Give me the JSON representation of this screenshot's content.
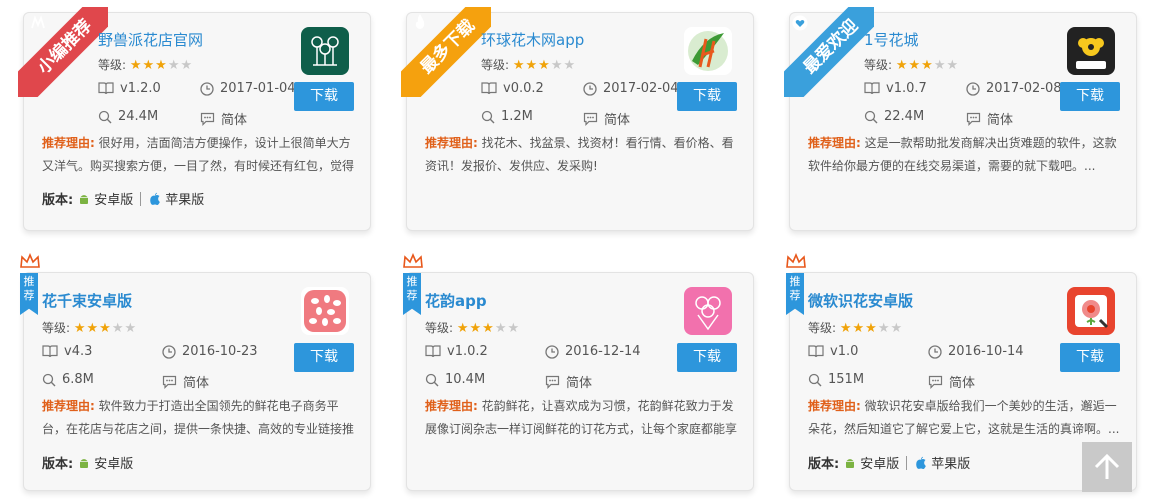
{
  "common": {
    "grade_label": "等级:",
    "download_label": "下载",
    "reason_label": "推荐理由:",
    "version_label": "版本:",
    "android_label": "安卓版",
    "ios_label": "苹果版"
  },
  "cards": [
    {
      "ribbon": "小编推荐",
      "title": "野兽派花店官网",
      "stars": "★★★",
      "stars_off": "★★",
      "version": "v1.2.0",
      "date": "2017-01-04",
      "size": "24.4M",
      "lang": "简体",
      "reason": "很好用，洁面简洁方便操作，设计上很简单大方又洋气。购买搜索方便，一目了然，有时候还有红包，觉得",
      "has_ios": true
    },
    {
      "ribbon": "最多下载",
      "title": "环球花木网app",
      "stars": "★★★",
      "stars_off": "★★",
      "version": "v0.0.2",
      "date": "2017-02-04",
      "size": "1.2M",
      "lang": "简体",
      "reason": "找花木、找盆景、找资材！看行情、看价格、看资讯！发报价、发供应、发采购!",
      "has_ios": false
    },
    {
      "ribbon": "最爱欢迎",
      "title": "1号花城",
      "stars": "★★★",
      "stars_off": "★★",
      "version": "v1.0.7",
      "date": "2017-02-08",
      "size": "22.4M",
      "lang": "简体",
      "reason": "这是一款帮助批发商解决出货难题的软件，这款软件给你最方便的在线交易渠道，需要的就下载吧。...",
      "has_ios": false
    },
    {
      "badge": "推荐",
      "title": "花千束安卓版",
      "stars": "★★★",
      "stars_off": "★★",
      "version": "v4.3",
      "date": "2016-10-23",
      "size": "6.8M",
      "lang": "简体",
      "reason": "软件致力于打造出全国领先的鲜花电子商务平台，在花店与花店之间，提供一条快捷、高效的专业链接推",
      "has_ios": false
    },
    {
      "badge": "推荐",
      "title": "花韵app",
      "stars": "★★★",
      "stars_off": "★★",
      "version": "v1.0.2",
      "date": "2016-12-14",
      "size": "10.4M",
      "lang": "简体",
      "reason": "花韵鲜花，让喜欢成为习惯，花韵鲜花致力于发展像订阅杂志一样订阅鲜花的订花方式，让每个家庭都能享",
      "has_ios": false
    },
    {
      "badge": "推荐",
      "title": "微软识花安卓版",
      "stars": "★★★",
      "stars_off": "★★",
      "version": "v1.0",
      "date": "2016-10-14",
      "size": "151M",
      "lang": "简体",
      "reason": "微软识花安卓版给我们一个美妙的生活，邂逅一朵花，然后知道它了解它爱上它，这就是生活的真谛啊。...",
      "has_ios": true
    }
  ],
  "colors": {
    "accent": "#2d96dc",
    "ribbon_red": "#e0474c",
    "ribbon_orange": "#f5a10e",
    "ribbon_blue": "#3aa0dc",
    "star": "#f0a30a",
    "reason": "#e0601a"
  }
}
